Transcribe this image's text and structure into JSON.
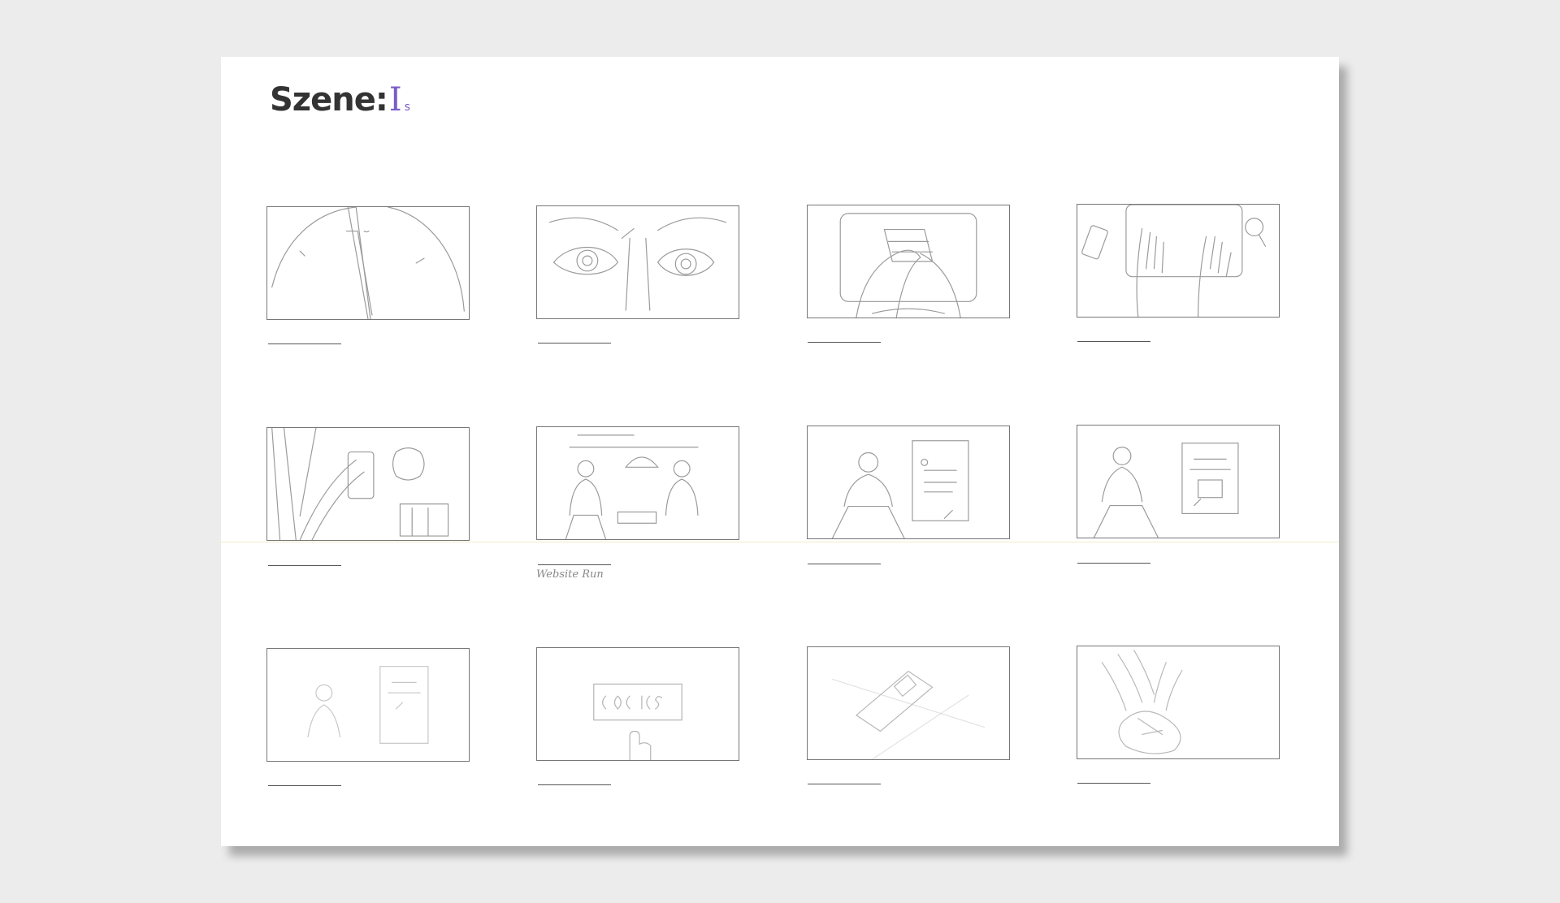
{
  "sheet": {
    "title_prefix": "Szene:",
    "title_handwritten": "I",
    "title_handwritten_small": "s"
  },
  "panels": [
    {
      "id": 1,
      "subject": "clock-sketch"
    },
    {
      "id": 2,
      "subject": "eyes-sketch"
    },
    {
      "id": 3,
      "subject": "hands-on-tablet-sketch"
    },
    {
      "id": 4,
      "subject": "hands-typing-sketch"
    },
    {
      "id": 5,
      "subject": "hand-holding-phone-sketch"
    },
    {
      "id": 6,
      "subject": "two-people-website-sketch",
      "caption": "Website Run"
    },
    {
      "id": 7,
      "subject": "person-with-screen-sketch"
    },
    {
      "id": 8,
      "subject": "person-with-document-sketch"
    },
    {
      "id": 9,
      "subject": "faint-person-with-screen-sketch"
    },
    {
      "id": 10,
      "subject": "button-click-sketch"
    },
    {
      "id": 11,
      "subject": "phone-on-table-sketch"
    },
    {
      "id": 12,
      "subject": "crumpled-hands-sketch"
    }
  ]
}
